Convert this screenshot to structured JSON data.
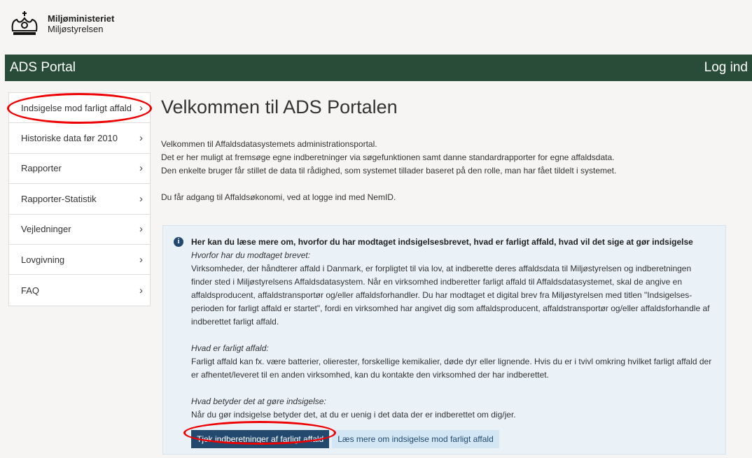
{
  "header": {
    "ministry": "Miljøministeriet",
    "agency": "Miljøstyrelsen",
    "logo_icon": "crown-icon"
  },
  "navbar": {
    "title": "ADS Portal",
    "login": "Log ind",
    "color": "#284c38"
  },
  "sidebar": {
    "items": [
      {
        "label": "Indsigelse mod farligt affald"
      },
      {
        "label": "Historiske data før 2010"
      },
      {
        "label": "Rapporter"
      },
      {
        "label": "Rapporter-Statistik"
      },
      {
        "label": "Vejledninger"
      },
      {
        "label": "Lovgivning"
      },
      {
        "label": "FAQ"
      }
    ]
  },
  "main": {
    "title": "Velkommen til ADS Portalen",
    "intro": [
      "Velkommen til Affaldsdatasystemets administrationsportal.",
      "Det er her muligt at fremsøge egne indberetninger via søgefunktionen samt danne standardrapporter for egne affaldsdata.",
      "Den enkelte bruger får stillet de data til rådighed, som systemet tillader baseret på den rolle, man har fået tildelt i systemet."
    ],
    "login_note": "Du får adgang til Affaldsøkonomi, ved at logge ind med NemID."
  },
  "infobox": {
    "heading": "Her kan du læse mere om, hvorfor du har modtaget indsigelsesbrevet, hvad er farligt affald, hvad vil det sige at gør indsigelse",
    "q1": "Hvorfor har du modtaget brevet:",
    "a1_lines": [
      "Virksomheder, der håndterer affald i Danmark, er forpligtet til via lov, at indberette deres affaldsdata til Miljøstyrelsen og indberetningen",
      "finder sted i Miljøstyrelsens Affaldsdatasystem. Når en virksomhed indberetter farligt affald til Affaldsdatasystemet, skal de angive en",
      "affaldsproducent, affaldstransportør og/eller affaldsforhandler. Du har modtaget et digital brev fra Miljøstyrelsen med titlen \"Indsigelses-",
      "perioden for farligt affald er startet\", fordi en virksomhed har angivet dig som affaldsproducent, affaldstransportør og/eller affaldsforhandle af",
      "indberettet farligt affald."
    ],
    "q2": "Hvad er farligt affald:",
    "a2_lines": [
      "Farligt affald kan fx. være batterier, olierester, forskellige kemikalier, døde dyr eller lignende. Hvis du er i tvivl omkring hvilket farligt affald der",
      "er afhentet/leveret til en anden virksomhed, kan du kontakte den virksomhed der har indberettet."
    ],
    "q3": "Hvad betyder det at gøre indsigelse:",
    "a3": "Når du gør indsigelse betyder det, at du er uenig i det data der er indberettet om dig/jer.",
    "btn_primary": "Tjek indberetninger af farligt affald",
    "btn_secondary": "Læs mere om indsigelse mod farligt affald"
  },
  "annotation_color": "#e00000"
}
